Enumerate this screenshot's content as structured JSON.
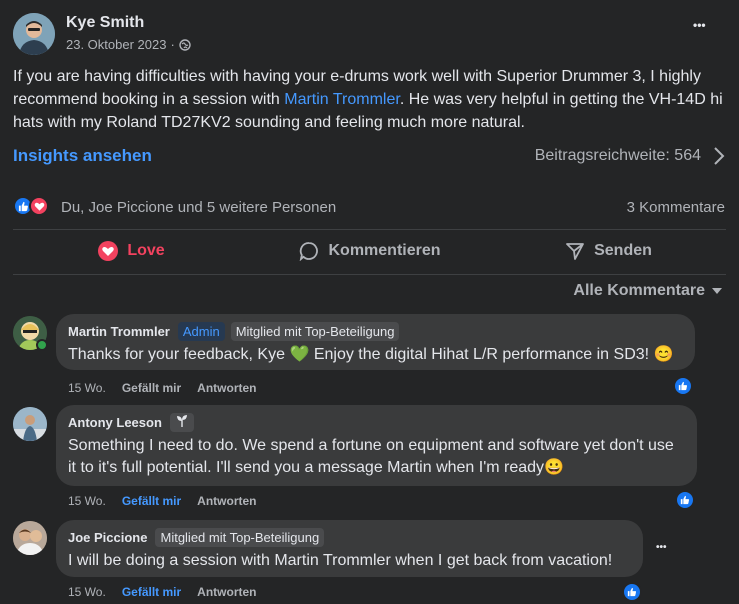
{
  "post": {
    "author": "Kye Smith",
    "date": "23. Oktober 2023",
    "date_separator": "·",
    "audience_icon": "globe-icon",
    "more_icon": "•••",
    "text_before": "If you are having difficulties with having your e-drums work well with Superior Drummer 3, I highly recommend booking in a session with ",
    "mention": "Martin Trommler",
    "text_after": ". He was very helpful in getting the VH-14D hi hats with my Roland TD27KV2 sounding and feeling much more natural."
  },
  "insights": {
    "link_label": "Insights ansehen",
    "reach_label": "Beitragsreichweite: 564"
  },
  "reactions": {
    "summary": "Du, Joe Piccione und 5 weitere Personen",
    "comments_count": "3 Kommentare",
    "colors": {
      "like": "#1877f2",
      "love": "#f3425f"
    }
  },
  "actions": {
    "love": "Love",
    "comment": "Kommentieren",
    "send": "Senden"
  },
  "sort": {
    "label": "Alle Kommentare"
  },
  "comments": [
    {
      "name": "Martin Trommler",
      "badges": [
        "Admin",
        "Mitglied mit Top-Beteiligung"
      ],
      "text": "Thanks for your feedback, Kye 💚 Enjoy the digital Hihat L/R performance in SD3! 😊",
      "time": "15 Wo.",
      "like": "Gefällt mir",
      "reply": "Antworten"
    },
    {
      "name": "Antony Leeson",
      "badges": [],
      "text": "Something I need to do. We spend a fortune on equipment and software yet don't use it to it's full potential. I'll send you a message Martin when I'm ready😀",
      "time": "15 Wo.",
      "like": "Gefällt mir",
      "reply": "Antworten"
    },
    {
      "name": "Joe Piccione",
      "badges": [
        "Mitglied mit Top-Beteiligung"
      ],
      "text": "I will be doing a session with Martin Trommler when I get back from vacation!",
      "time": "15 Wo.",
      "like": "Gefällt mir",
      "reply": "Antworten"
    }
  ],
  "colors": {
    "background": "#242526",
    "bubble": "#3a3b3c",
    "link": "#4599ff",
    "secondary_text": "#b0b3b8"
  }
}
